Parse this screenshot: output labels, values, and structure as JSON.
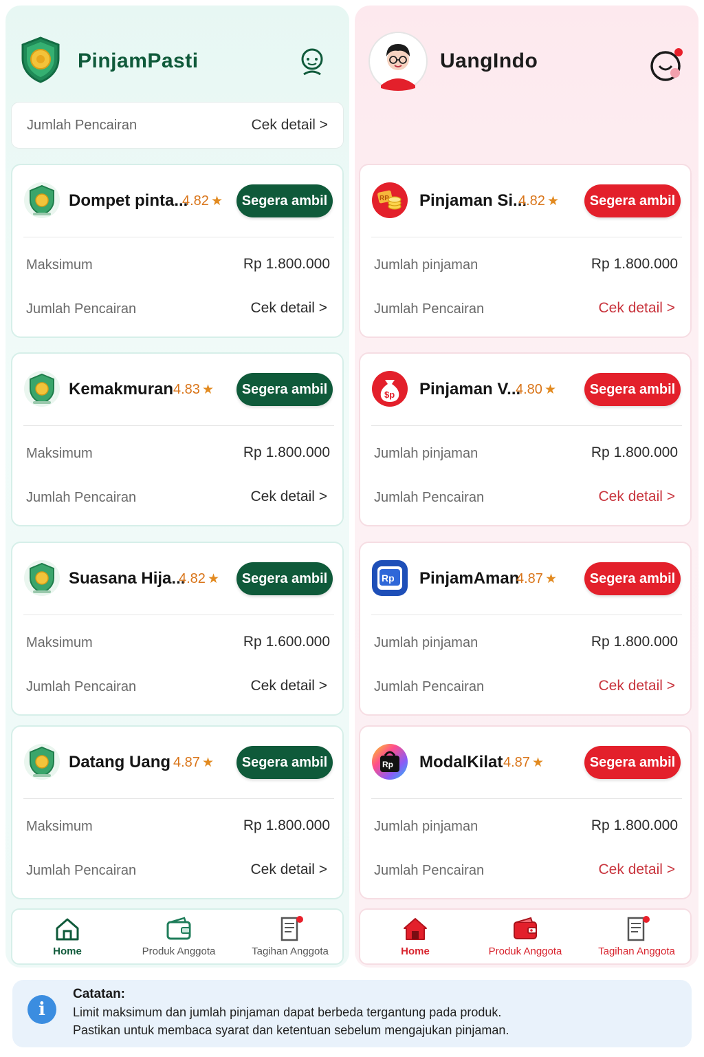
{
  "colors": {
    "green_accent": "#0f5a3a",
    "red_accent": "#e3202b",
    "rating_orange": "#d9751a",
    "link_red": "#c8333c"
  },
  "left": {
    "app_title": "PinjamPasti",
    "header_icon": "support-agent-icon",
    "summary": {
      "label": "Jumlah Pencairan",
      "link": "Cek detail >"
    },
    "cards": [
      {
        "name": "Dompet pinta...",
        "rating": "4.82",
        "cta": "Segera ambil",
        "row1_label": "Maksimum",
        "row1_value": "Rp 1.800.000",
        "row2_label": "Jumlah Pencairan",
        "row2_link": "Cek detail >",
        "logo": "shield-coin-icon"
      },
      {
        "name": "Kemakmuran",
        "rating": "4.83",
        "cta": "Segera ambil",
        "row1_label": "Maksimum",
        "row1_value": "Rp 1.800.000",
        "row2_label": "Jumlah Pencairan",
        "row2_link": "Cek detail >",
        "logo": "shield-coin-icon"
      },
      {
        "name": "Suasana Hija...",
        "rating": "4.82",
        "cta": "Segera ambil",
        "row1_label": "Maksimum",
        "row1_value": "Rp 1.600.000",
        "row2_label": "Jumlah Pencairan",
        "row2_link": "Cek detail >",
        "logo": "shield-coin-icon"
      },
      {
        "name": "Datang Uang",
        "rating": "4.87",
        "cta": "Segera ambil",
        "row1_label": "Maksimum",
        "row1_value": "Rp 1.800.000",
        "row2_label": "Jumlah Pencairan",
        "row2_link": "Cek detail >",
        "logo": "shield-coin-icon"
      }
    ],
    "nav": [
      {
        "label": "Home",
        "icon": "home-icon",
        "active": true
      },
      {
        "label": "Produk Anggota",
        "icon": "wallet-icon",
        "active": false
      },
      {
        "label": "Tagihan Anggota",
        "icon": "bill-icon",
        "active": false
      }
    ]
  },
  "right": {
    "app_title": "UangIndo",
    "header_icon": "chat-bubble-icon",
    "cards": [
      {
        "name": "Pinjaman Si...",
        "rating": "4.82",
        "cta": "Segera ambil",
        "row1_label": "Jumlah pinjaman",
        "row1_value": "Rp 1.800.000",
        "row2_label": "Jumlah Pencairan",
        "row2_link": "Cek detail >",
        "logo": "rp-coins-icon"
      },
      {
        "name": "Pinjaman V...",
        "rating": "4.80",
        "cta": "Segera ambil",
        "row1_label": "Jumlah pinjaman",
        "row1_value": "Rp 1.800.000",
        "row2_label": "Jumlah Pencairan",
        "row2_link": "Cek detail >",
        "logo": "money-bag-icon"
      },
      {
        "name": "PinjamAman",
        "rating": "4.87",
        "cta": "Segera ambil",
        "row1_label": "Jumlah pinjaman",
        "row1_value": "Rp 1.800.000",
        "row2_label": "Jumlah Pencairan",
        "row2_link": "Cek detail >",
        "logo": "rp-badge-icon"
      },
      {
        "name": "ModalKilat",
        "rating": "4.87",
        "cta": "Segera ambil",
        "row1_label": "Jumlah pinjaman",
        "row1_value": "Rp 1.800.000",
        "row2_label": "Jumlah Pencairan",
        "row2_link": "Cek detail >",
        "logo": "rp-bag-icon"
      }
    ],
    "nav": [
      {
        "label": "Home",
        "icon": "home-icon",
        "active": true
      },
      {
        "label": "Produk Anggota",
        "icon": "wallet-icon",
        "active": false
      },
      {
        "label": "Tagihan Anggota",
        "icon": "bill-icon",
        "active": false
      }
    ]
  },
  "note": {
    "title": "Catatan:",
    "line1": "Limit maksimum dan jumlah pinjaman dapat berbeda tergantung pada produk.",
    "line2": "Pastikan untuk membaca syarat dan ketentuan sebelum mengajukan pinjaman.",
    "icon": "info-icon"
  }
}
